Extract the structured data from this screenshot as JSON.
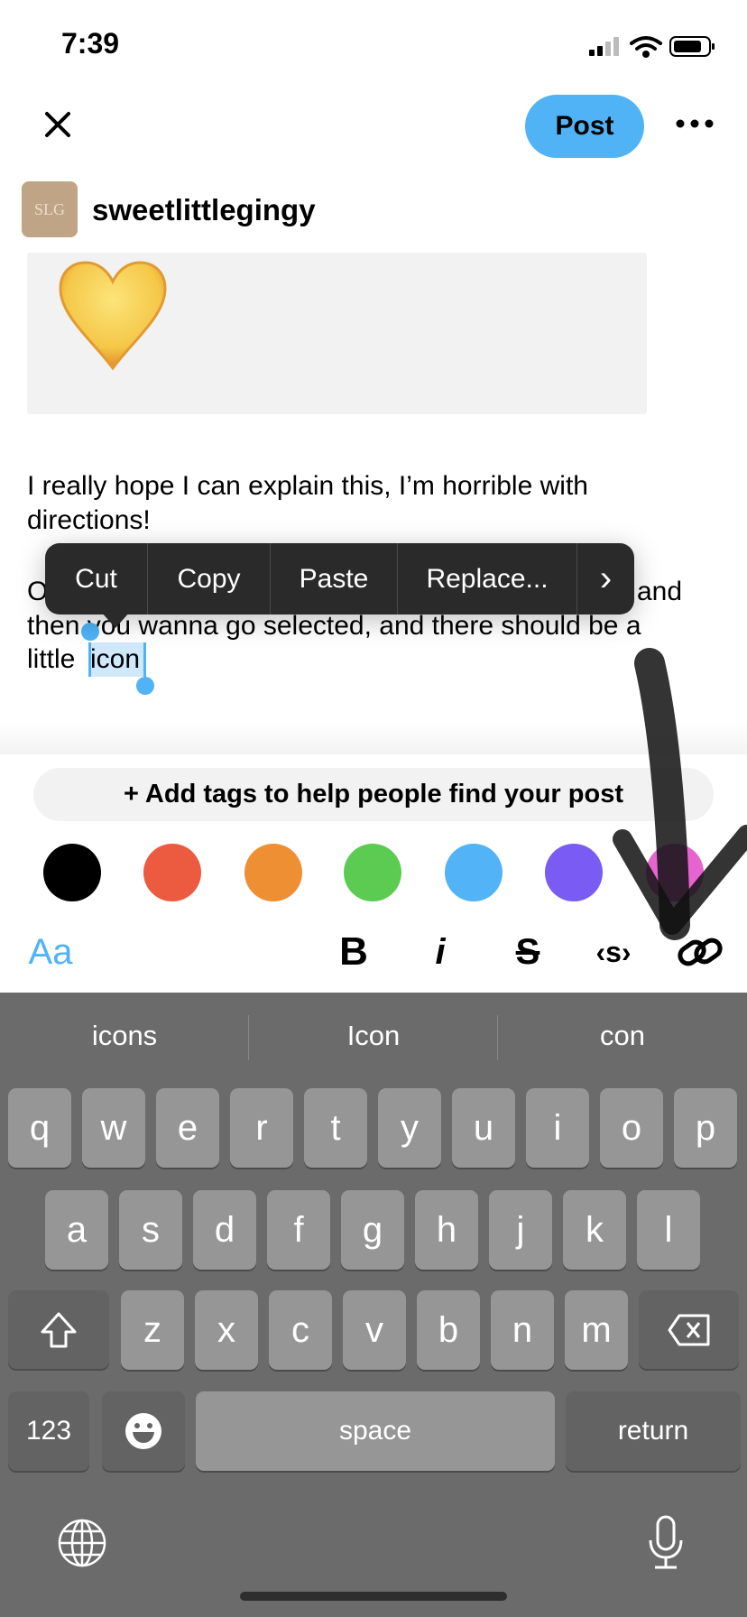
{
  "status": {
    "time": "7:39"
  },
  "header": {
    "close_icon": "x-icon",
    "post_label": "Post",
    "more_icon": "ellipsis-icon"
  },
  "author": {
    "avatar_text": "SLG",
    "username": "sweetlittlegingy"
  },
  "image_block": {
    "emoji": "💛"
  },
  "body": {
    "para1": [
      "I really hope I can explain this, I’m horrible with",
      "directions!"
    ],
    "para2_first_visible_start": "O",
    "para2_first_visible_end": "and",
    "para2_line2": "then you wanna go selected, and there should be a",
    "para2_line3_prefix": "little ",
    "selected_text": "icon"
  },
  "context_menu": {
    "items": [
      "Cut",
      "Copy",
      "Paste",
      "Replace..."
    ],
    "more": "›"
  },
  "tags": {
    "label": "+ Add tags to help people find your post"
  },
  "colors": [
    "#000000",
    "#ec5a40",
    "#ef8f34",
    "#5ccb52",
    "#52b4f7",
    "#7a5cf4",
    "#e564cf"
  ],
  "toolbar": {
    "text_style": "Aa",
    "bold": "B",
    "italic": "i",
    "strike": "S",
    "code": "‹s›",
    "link_icon": "link-icon",
    "accent": "#4fb3f6"
  },
  "keyboard": {
    "suggestions": [
      "icons",
      "Icon",
      "con"
    ],
    "row1": [
      "q",
      "w",
      "e",
      "r",
      "t",
      "y",
      "u",
      "i",
      "o",
      "p"
    ],
    "row2": [
      "a",
      "s",
      "d",
      "f",
      "g",
      "h",
      "j",
      "k",
      "l"
    ],
    "row3": [
      "z",
      "x",
      "c",
      "v",
      "b",
      "n",
      "m"
    ],
    "numbers": "123",
    "space": "space",
    "return": "return"
  }
}
